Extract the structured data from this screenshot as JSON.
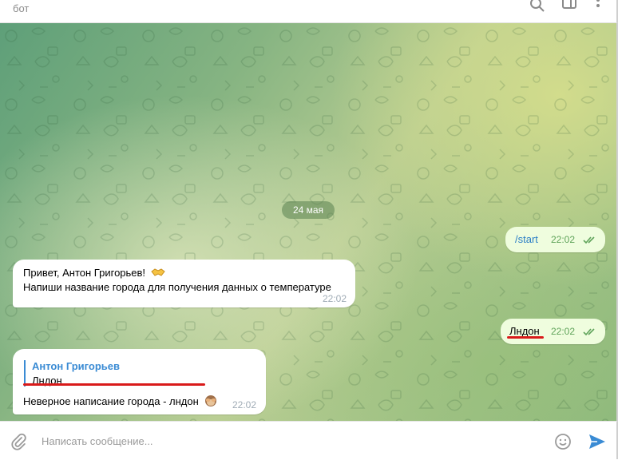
{
  "header": {
    "subtitle": "бот",
    "icons": [
      "search-icon",
      "side-panel-icon",
      "more-vertical-icon"
    ]
  },
  "chat": {
    "date_separator": "24 мая",
    "messages": [
      {
        "id": "m1",
        "direction": "outgoing",
        "text": "/start",
        "time": "22:02",
        "status": "read"
      },
      {
        "id": "m2",
        "direction": "incoming",
        "line1": "Привет, Антон Григорьев!",
        "line1_emoji": "handshake-emoji",
        "line2": "Напиши название города для получения данных о температуре",
        "time": "22:02"
      },
      {
        "id": "m3",
        "direction": "outgoing",
        "text": "Лндон",
        "time": "22:02",
        "status": "read"
      },
      {
        "id": "m4",
        "direction": "incoming",
        "reply_name": "Антон Григорьев",
        "reply_text": "Лндон",
        "text": "Неверное написание города - лндон",
        "text_emoji": "see-no-evil-monkey-emoji",
        "time": "22:02"
      }
    ]
  },
  "annotations": {
    "underline_color": "#d91a1a"
  },
  "input": {
    "placeholder": "Написать сообщение...",
    "value": ""
  },
  "colors": {
    "accent": "#3a8bd4",
    "outgoing_bubble": "#effdde",
    "read_ticks": "#5fa35a"
  }
}
